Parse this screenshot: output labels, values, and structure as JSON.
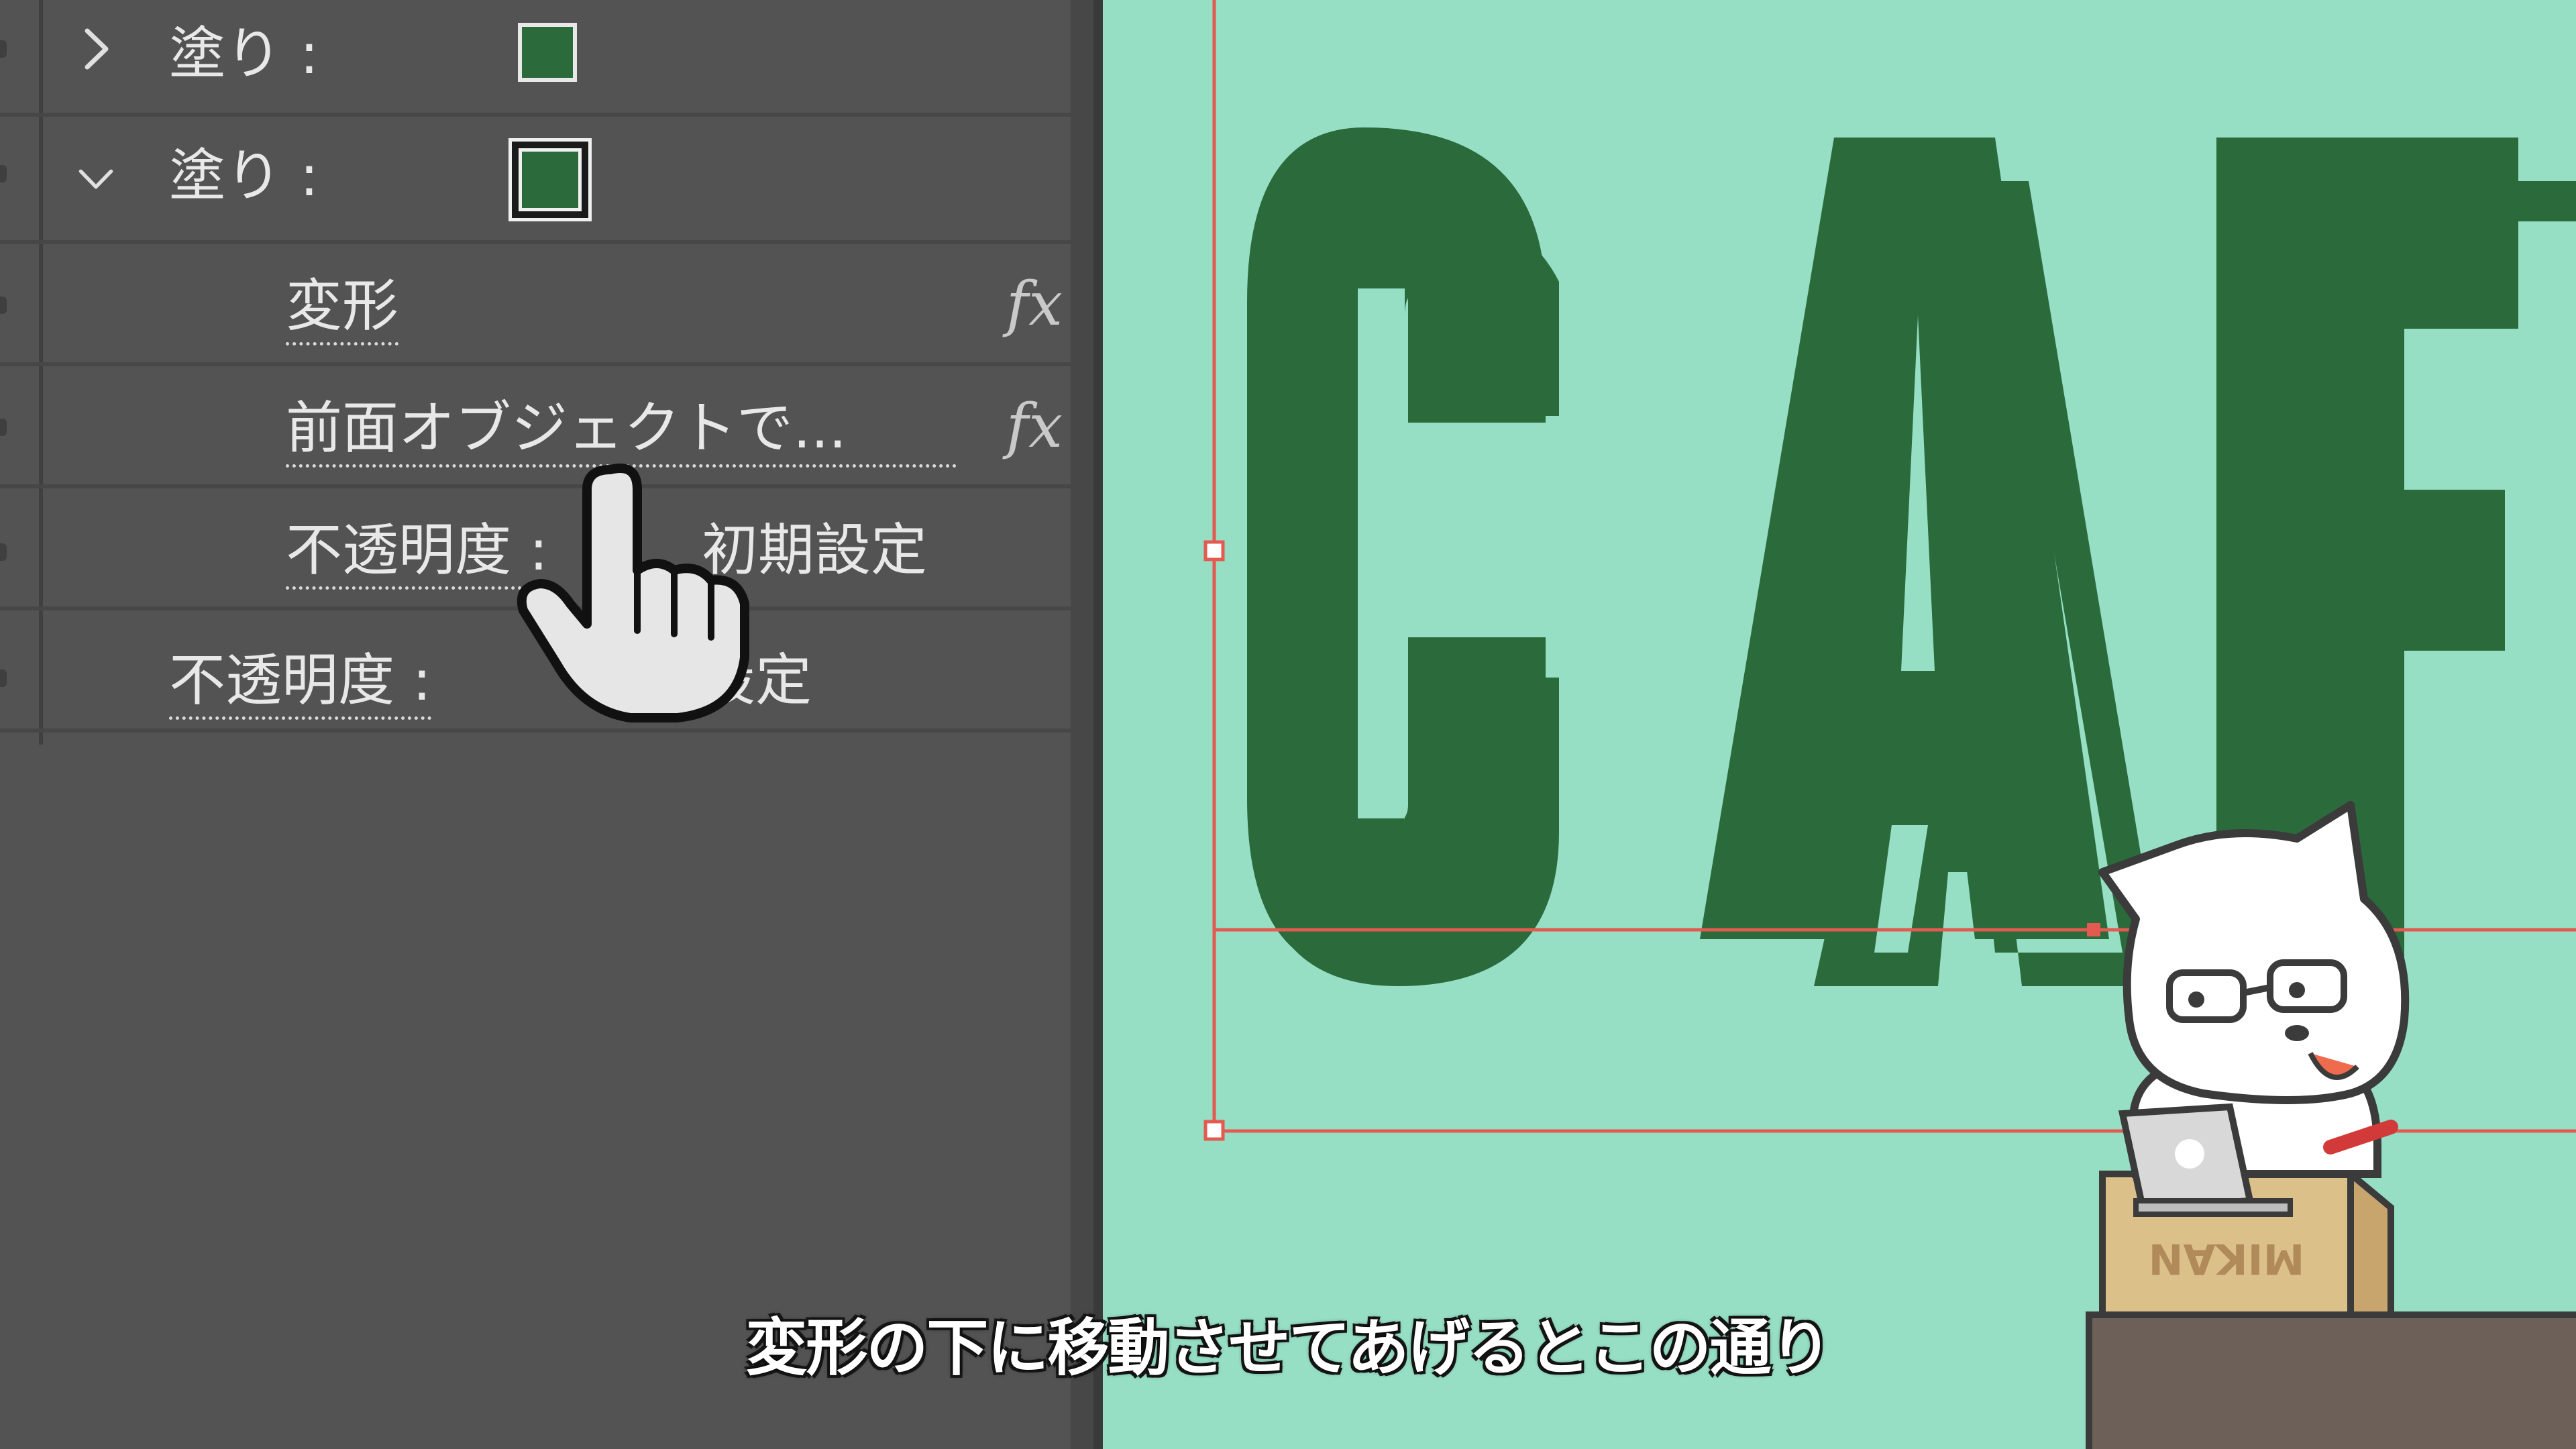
{
  "panel": {
    "rows": [
      {
        "label": "塗り :",
        "expanded": false,
        "swatch_color": "#2a6a3b"
      },
      {
        "label": "塗り :",
        "expanded": true,
        "swatch_color": "#2a6a3b",
        "selected": true
      },
      {
        "label": "変形",
        "fx": "fx"
      },
      {
        "label": "前面オブジェクトで...",
        "fx": "fx"
      },
      {
        "label": "不透明度 :",
        "value": "初期設定"
      },
      {
        "label": "不透明度 :",
        "value": "初期設定"
      }
    ]
  },
  "canvas": {
    "background": "#96dfc5",
    "artwork_text": "CAF",
    "artwork_color": "#2a6a3b",
    "selection_color": "#e45a50",
    "box_label": "MIKAN"
  },
  "subtitle": "変形の下に移動させてあげるとこの通り"
}
